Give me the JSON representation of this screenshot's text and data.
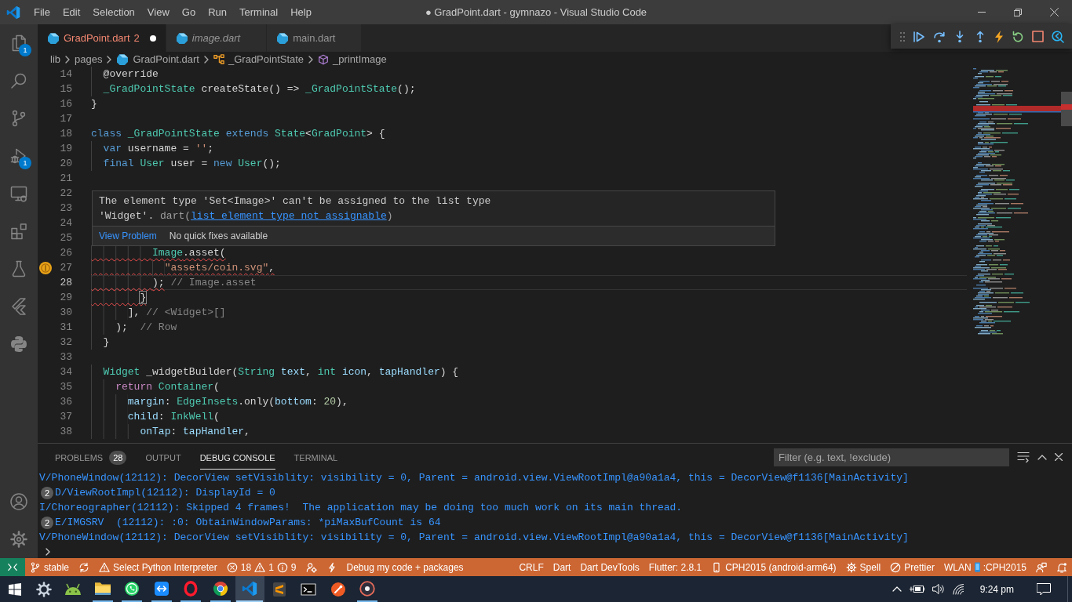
{
  "title_bar": {
    "menu": [
      "File",
      "Edit",
      "Selection",
      "View",
      "Go",
      "Run",
      "Terminal",
      "Help"
    ],
    "title": "● GradPoint.dart - gymnazo - Visual Studio Code"
  },
  "activity_bar": {
    "items": [
      {
        "kind": "explorer",
        "badge": "1"
      },
      {
        "kind": "search"
      },
      {
        "kind": "source_control"
      },
      {
        "kind": "debug",
        "badge": "1"
      },
      {
        "kind": "remote"
      },
      {
        "kind": "extensions"
      },
      {
        "kind": "testing"
      },
      {
        "kind": "flutter"
      },
      {
        "kind": "python"
      }
    ],
    "bottom": [
      {
        "kind": "account"
      },
      {
        "kind": "manage"
      }
    ]
  },
  "tabs": [
    {
      "label": "GradPoint.dart",
      "problems": "2",
      "selected": true,
      "dirty": true,
      "preview": false
    },
    {
      "label": "image.dart",
      "selected": false,
      "dirty": false,
      "preview": true
    },
    {
      "label": "main.dart",
      "selected": false,
      "dirty": false,
      "preview": false
    }
  ],
  "breadcrumbs": [
    {
      "label": "lib",
      "kind": "folder"
    },
    {
      "label": "pages",
      "kind": "folder"
    },
    {
      "label": "GradPoint.dart",
      "kind": "file"
    },
    {
      "label": "_GradPointState",
      "kind": "class"
    },
    {
      "label": "_printImage",
      "kind": "method"
    }
  ],
  "editor": {
    "lines": [
      {
        "number": "14",
        "error": false,
        "current": false,
        "preview_icon": false,
        "tokens": [
          {
            "text": "  @override",
            "kind": "plain"
          }
        ]
      },
      {
        "number": "15",
        "error": false,
        "current": false,
        "preview_icon": false,
        "tokens": [
          {
            "text": "  _GradPointState",
            "kind": "type"
          },
          {
            "text": " createState() => ",
            "kind": "plain"
          },
          {
            "text": "_GradPointState",
            "kind": "type"
          },
          {
            "text": "();",
            "kind": "plain"
          }
        ]
      },
      {
        "number": "16",
        "error": false,
        "current": false,
        "preview_icon": false,
        "tokens": [
          {
            "text": "}",
            "kind": "plain"
          }
        ]
      },
      {
        "number": "17",
        "error": false,
        "current": false,
        "preview_icon": false
      },
      {
        "number": "18",
        "error": false,
        "current": false,
        "preview_icon": false,
        "tokens": [
          {
            "text": "class",
            "kind": "keyword"
          },
          {
            "text": " _GradPointState",
            "kind": "type"
          },
          {
            "text": " extends",
            "kind": "keyword"
          },
          {
            "text": " State",
            "kind": "type"
          },
          {
            "text": "<",
            "kind": "plain"
          },
          {
            "text": "GradPoint",
            "kind": "type"
          },
          {
            "text": "> {",
            "kind": "plain"
          }
        ]
      },
      {
        "number": "19",
        "error": false,
        "current": false,
        "preview_icon": false,
        "tokens": [
          {
            "text": "  var",
            "kind": "keyword"
          },
          {
            "text": " username = ",
            "kind": "plain"
          },
          {
            "text": "''",
            "kind": "string"
          },
          {
            "text": ";",
            "kind": "plain"
          }
        ]
      },
      {
        "number": "20",
        "error": false,
        "current": false,
        "preview_icon": false,
        "tokens": [
          {
            "text": "  final",
            "kind": "keyword"
          },
          {
            "text": " User",
            "kind": "type"
          },
          {
            "text": " user = ",
            "kind": "plain"
          },
          {
            "text": "new",
            "kind": "keyword"
          },
          {
            "text": " User",
            "kind": "type"
          },
          {
            "text": "();",
            "kind": "plain"
          }
        ]
      },
      {
        "number": "21",
        "error": false,
        "current": false,
        "preview_icon": false
      },
      {
        "number": "22",
        "error": false,
        "current": false,
        "preview_icon": false
      },
      {
        "number": "23",
        "error": false,
        "current": false,
        "preview_icon": false
      },
      {
        "number": "24",
        "error": false,
        "current": false,
        "preview_icon": false
      },
      {
        "number": "25",
        "error": false,
        "current": false,
        "preview_icon": false
      },
      {
        "number": "26",
        "error": true,
        "current": false,
        "preview_icon": false,
        "tokens": [
          {
            "text": "          Image",
            "kind": "type"
          },
          {
            "text": ".asset(",
            "kind": "plain"
          }
        ]
      },
      {
        "number": "27",
        "error": true,
        "current": false,
        "preview_icon": true,
        "tokens": [
          {
            "text": "            \"assets/coin.svg\"",
            "kind": "string"
          },
          {
            "text": ",",
            "kind": "plain"
          }
        ]
      },
      {
        "number": "28",
        "error": true,
        "current": true,
        "preview_icon": false,
        "tokens": [
          {
            "text": "          );",
            "kind": "plain"
          },
          {
            "text": " // Image.asset",
            "kind": "closing_label"
          }
        ]
      },
      {
        "number": "29",
        "error": true,
        "current": false,
        "preview_icon": false,
        "tokens": [
          {
            "text": "        }",
            "kind": "bracket_match"
          }
        ]
      },
      {
        "number": "30",
        "error": false,
        "current": false,
        "preview_icon": false,
        "tokens": [
          {
            "text": "      ],",
            "kind": "plain"
          },
          {
            "text": " // <Widget>[]",
            "kind": "closing_label"
          }
        ]
      },
      {
        "number": "31",
        "error": false,
        "current": false,
        "preview_icon": false,
        "tokens": [
          {
            "text": "    );",
            "kind": "plain"
          },
          {
            "text": "  // Row",
            "kind": "closing_label"
          }
        ]
      },
      {
        "number": "32",
        "error": false,
        "current": false,
        "preview_icon": false,
        "tokens": [
          {
            "text": "  }",
            "kind": "plain"
          }
        ]
      },
      {
        "number": "33",
        "error": false,
        "current": false,
        "preview_icon": false
      },
      {
        "number": "34",
        "error": false,
        "current": false,
        "preview_icon": false,
        "tokens": [
          {
            "text": "  Widget",
            "kind": "type"
          },
          {
            "text": " _widgetBuilder(",
            "kind": "plain"
          },
          {
            "text": "String",
            "kind": "type"
          },
          {
            "text": " text",
            "kind": "param"
          },
          {
            "text": ", ",
            "kind": "plain"
          },
          {
            "text": "int",
            "kind": "type"
          },
          {
            "text": " icon",
            "kind": "param"
          },
          {
            "text": ", ",
            "kind": "plain"
          },
          {
            "text": "tapHandler",
            "kind": "param"
          },
          {
            "text": ") {",
            "kind": "plain"
          }
        ]
      },
      {
        "number": "35",
        "error": false,
        "current": false,
        "preview_icon": false,
        "tokens": [
          {
            "text": "    return",
            "kind": "control"
          },
          {
            "text": " Container",
            "kind": "type"
          },
          {
            "text": "(",
            "kind": "plain"
          }
        ]
      },
      {
        "number": "36",
        "error": false,
        "current": false,
        "preview_icon": false,
        "tokens": [
          {
            "text": "      margin",
            "kind": "param"
          },
          {
            "text": ": ",
            "kind": "plain"
          },
          {
            "text": "EdgeInsets",
            "kind": "type"
          },
          {
            "text": ".only(",
            "kind": "plain"
          },
          {
            "text": "bottom",
            "kind": "param"
          },
          {
            "text": ": ",
            "kind": "plain"
          },
          {
            "text": "20",
            "kind": "number"
          },
          {
            "text": "),",
            "kind": "plain"
          }
        ]
      },
      {
        "number": "37",
        "error": false,
        "current": false,
        "preview_icon": false,
        "tokens": [
          {
            "text": "      child",
            "kind": "param"
          },
          {
            "text": ": ",
            "kind": "plain"
          },
          {
            "text": "InkWell",
            "kind": "type"
          },
          {
            "text": "(",
            "kind": "plain"
          }
        ]
      },
      {
        "number": "38",
        "error": false,
        "current": false,
        "preview_icon": false,
        "tokens": [
          {
            "text": "        onTap",
            "kind": "param"
          },
          {
            "text": ": ",
            "kind": "plain"
          },
          {
            "text": "tapHandler",
            "kind": "param"
          },
          {
            "text": ",",
            "kind": "plain"
          }
        ]
      }
    ],
    "hover": {
      "message": "The element type 'Set<Image>' can't be assigned to the list type 'Widget'.",
      "source": "dart(",
      "code": "list_element_type_not_assignable",
      "source_end": ")",
      "actions": [
        {
          "kind": "link",
          "label": "View Problem"
        },
        {
          "kind": "note",
          "label": "No quick fixes available"
        }
      ]
    }
  },
  "panel": {
    "tabs": [
      {
        "label": "PROBLEMS",
        "badge": "28",
        "selected": false
      },
      {
        "label": "OUTPUT",
        "selected": false
      },
      {
        "label": "DEBUG CONSOLE",
        "selected": true
      },
      {
        "label": "TERMINAL",
        "selected": false
      }
    ],
    "filter": {
      "placeholder": "Filter (e.g. text, !exclude)"
    },
    "console": [
      {
        "text": "V/PhoneWindow(12112): DecorView setVisiblity: visibility = 0, Parent = android.view.ViewRootImpl@a90a1a4, this = DecorView@f1136[MainActivity]"
      },
      {
        "repeat": "2",
        "text": "D/ViewRootImpl(12112): DisplayId = 0"
      },
      {
        "text": "I/Choreographer(12112): Skipped 4 frames!  The application may be doing too much work on its main thread."
      },
      {
        "repeat": "2",
        "text": "E/IMGSRV  (12112): :0: ObtainWindowParams: *piMaxBufCount is 64"
      },
      {
        "text": "V/PhoneWindow(12112): DecorView setVisiblity: visibility = 0, Parent = android.view.ViewRootImpl@a90a1a4, this = DecorView@f1136[MainActivity]"
      }
    ]
  },
  "status_bar": {
    "left": [
      {
        "kind": "remote"
      },
      {
        "kind": "branch",
        "label": "stable"
      },
      {
        "kind": "sync"
      },
      {
        "kind": "warning",
        "label": "Select Python Interpreter"
      },
      {
        "kind": "problems",
        "errors": "18",
        "warnings": "1",
        "infos": "9"
      },
      {
        "kind": "person"
      },
      {
        "kind": "lightning"
      },
      {
        "kind": "text",
        "label": "Debug my code + packages"
      }
    ],
    "right": [
      {
        "kind": "text",
        "label": "CRLF"
      },
      {
        "kind": "text",
        "label": "Dart"
      },
      {
        "kind": "text",
        "label": "Dart DevTools"
      },
      {
        "kind": "text",
        "label": "Flutter: 2.8.1"
      },
      {
        "kind": "device",
        "label": "CPH2015 (android-arm64)"
      },
      {
        "kind": "spell",
        "label": "Spell"
      },
      {
        "kind": "formatter",
        "label": "Prettier"
      },
      {
        "kind": "wlan",
        "label": "WLAN",
        "suffix": ":CPH2015"
      },
      {
        "kind": "feedback"
      },
      {
        "kind": "bell"
      }
    ]
  },
  "taskbar": {
    "apps": [
      {
        "kind": "settings",
        "open": false,
        "selected": false
      },
      {
        "kind": "android",
        "open": false,
        "selected": false
      },
      {
        "kind": "files",
        "open": true,
        "selected": false
      },
      {
        "kind": "whatsapp",
        "open": true,
        "selected": false
      },
      {
        "kind": "remote_desktop",
        "open": true,
        "selected": false
      },
      {
        "kind": "opera",
        "open": true,
        "selected": false
      },
      {
        "kind": "chrome",
        "open": true,
        "selected": false
      },
      {
        "kind": "vscode",
        "open": true,
        "selected": true
      },
      {
        "kind": "sublime",
        "open": false,
        "selected": false
      },
      {
        "kind": "terminal",
        "open": false,
        "selected": false
      },
      {
        "kind": "postman",
        "open": false,
        "selected": false
      },
      {
        "kind": "media",
        "open": true,
        "selected": false
      }
    ],
    "clock": "9:24 pm"
  }
}
